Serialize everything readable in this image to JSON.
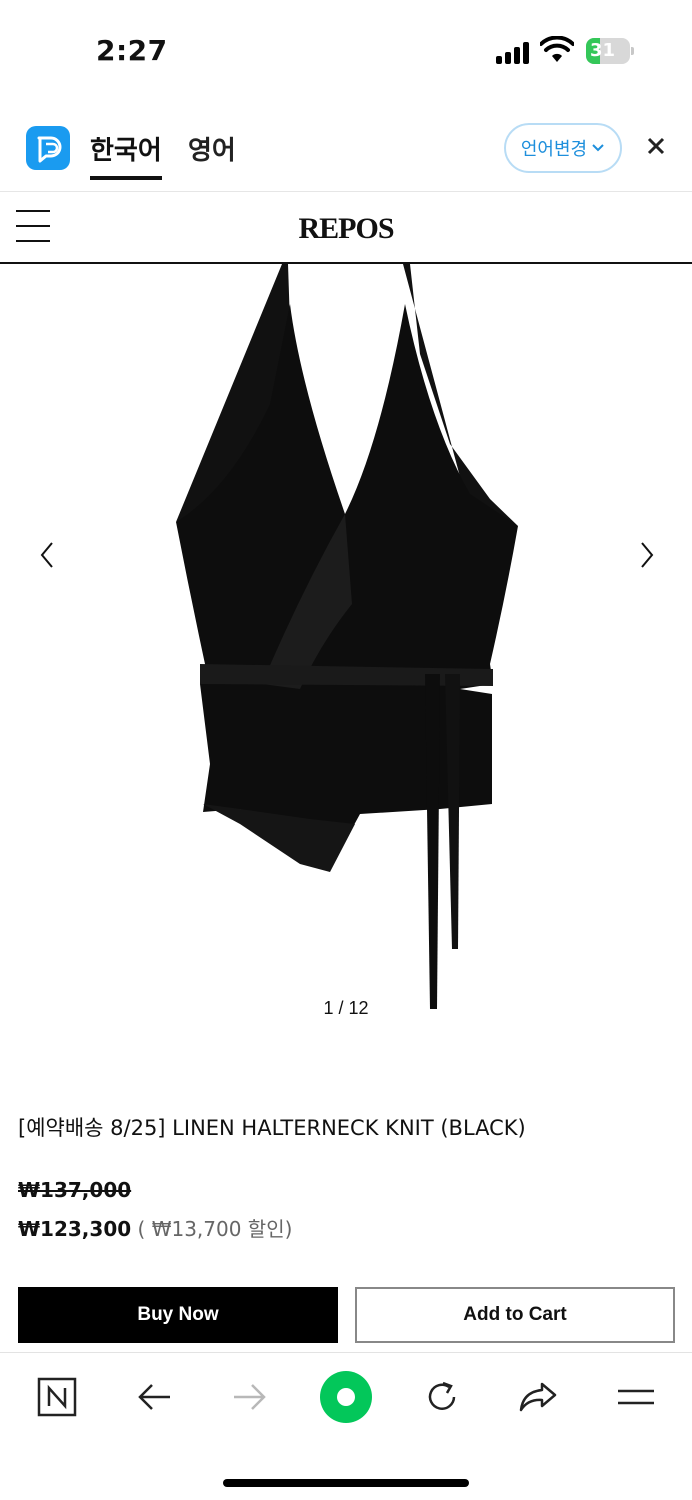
{
  "status_bar": {
    "time": "2:27",
    "battery": "31",
    "battery_level": 0.31
  },
  "translate_bar": {
    "source_lang": "한국어",
    "target_lang": "영어",
    "change_label": "언어변경"
  },
  "site": {
    "logo": "REPOS"
  },
  "gallery": {
    "pager": "1 / 12"
  },
  "product": {
    "title": "[예약배송 8/25] LINEN HALTERNECK KNIT (BLACK)",
    "original_price": "₩137,000",
    "sale_price": "₩123,300",
    "discount_open": " ( ",
    "discount_amount": "₩13,700",
    "discount_label": " 할인)",
    "buy_now": "Buy Now",
    "add_to_cart": "Add to Cart"
  },
  "colors": {
    "accent_blue": "#1e8fdc",
    "naver_green": "#03c75a",
    "battery_green": "#34c759"
  },
  "toolbar": {
    "icons": [
      "naver-n-icon",
      "back-arrow-icon",
      "forward-arrow-icon",
      "green-home-icon",
      "refresh-icon",
      "share-icon",
      "menu-icon"
    ]
  }
}
